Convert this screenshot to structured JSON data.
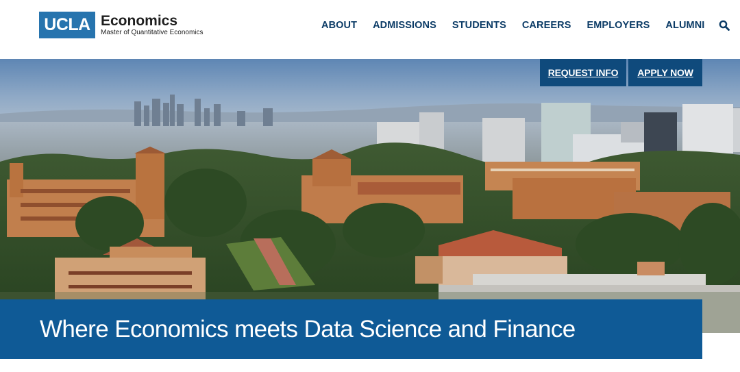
{
  "logo": {
    "mark": "UCLA",
    "title": "Economics",
    "subtitle": "Master of Quantitative Economics"
  },
  "nav": {
    "items": [
      {
        "label": "ABOUT"
      },
      {
        "label": "ADMISSIONS"
      },
      {
        "label": "STUDENTS"
      },
      {
        "label": "CAREERS"
      },
      {
        "label": "EMPLOYERS"
      },
      {
        "label": "ALUMNI"
      }
    ],
    "search_icon": "search-icon"
  },
  "cta": {
    "request_label": "REQUEST INFO",
    "apply_label": "APPLY NOW"
  },
  "hero": {
    "headline": "Where Economics meets Data Science and Finance",
    "image": "aerial-campus-photo"
  },
  "colors": {
    "brand_blue": "#2774ae",
    "nav_text": "#0b3b66",
    "cta_bg": "#0f4a7c",
    "banner_bg": "#0f5a96"
  }
}
